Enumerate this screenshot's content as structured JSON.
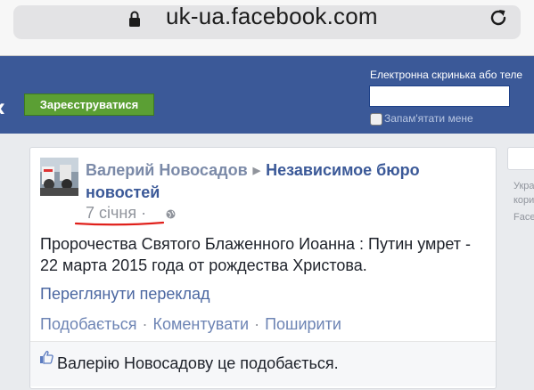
{
  "browser": {
    "url": "uk-ua.facebook.com"
  },
  "header": {
    "signup_label": "Зареєструватися",
    "login_label": "Електронна скринька або теле",
    "remember_label": "Запам'ятати мене"
  },
  "post": {
    "author": "Валерий Новосадов",
    "page": "Независимое бюро новостей",
    "date": "7 січня ·",
    "text": "Пророчества Святого Блаженного Иоанна : Путин умрет - 22 марта 2015 года от рождества Христова.",
    "translate_label": "Переглянути переклад",
    "actions": {
      "like": "Подобається",
      "comment": "Коментувати",
      "share": "Поширити",
      "separator": "·"
    },
    "likes_text": "Валерію Новосадову це подобається."
  },
  "sidebar": {
    "lines": [
      "Укра",
      "кори",
      "Face"
    ]
  },
  "colors": {
    "header_blue": "#3b5998",
    "signup_green": "#5b9f34",
    "link_blue": "#3b5998",
    "underline_red": "#e0201b"
  }
}
